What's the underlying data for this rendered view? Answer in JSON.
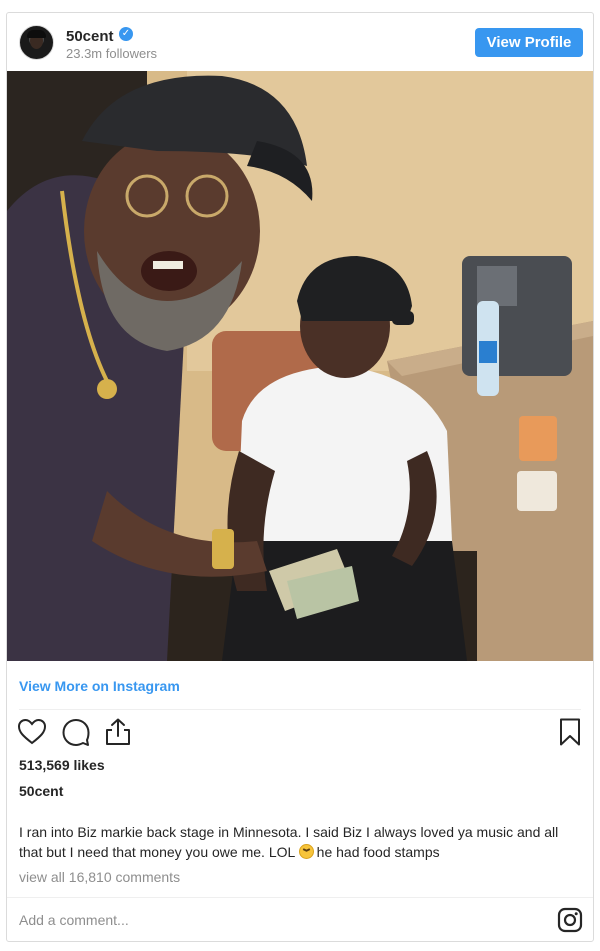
{
  "post": {
    "username": "50cent",
    "followers": "23.3m followers",
    "view_profile_label": "View Profile",
    "view_more_label": "View More on Instagram",
    "likes": "513,569 likes",
    "owner": "50cent",
    "caption_before_emoji": "I ran into Biz markie back stage in Minnesota. I said Biz I always loved ya music and all that but I need that money you owe me. LOL ",
    "caption_after_emoji": "he had food stamps",
    "view_all_comments": "view all 16,810 comments",
    "add_comment_placeholder": "Add a comment..."
  },
  "icons": {
    "verified": "verified-badge-icon",
    "like": "heart-icon",
    "comment": "comment-bubble-icon",
    "share": "share-icon",
    "save": "bookmark-icon",
    "instagram": "instagram-logo-icon",
    "emoji": "grinning-squinting-face-emoji"
  },
  "colors": {
    "accent": "#3897f0",
    "text": "#262626",
    "muted": "#8e8e8e",
    "border": "#dbdbdb"
  }
}
